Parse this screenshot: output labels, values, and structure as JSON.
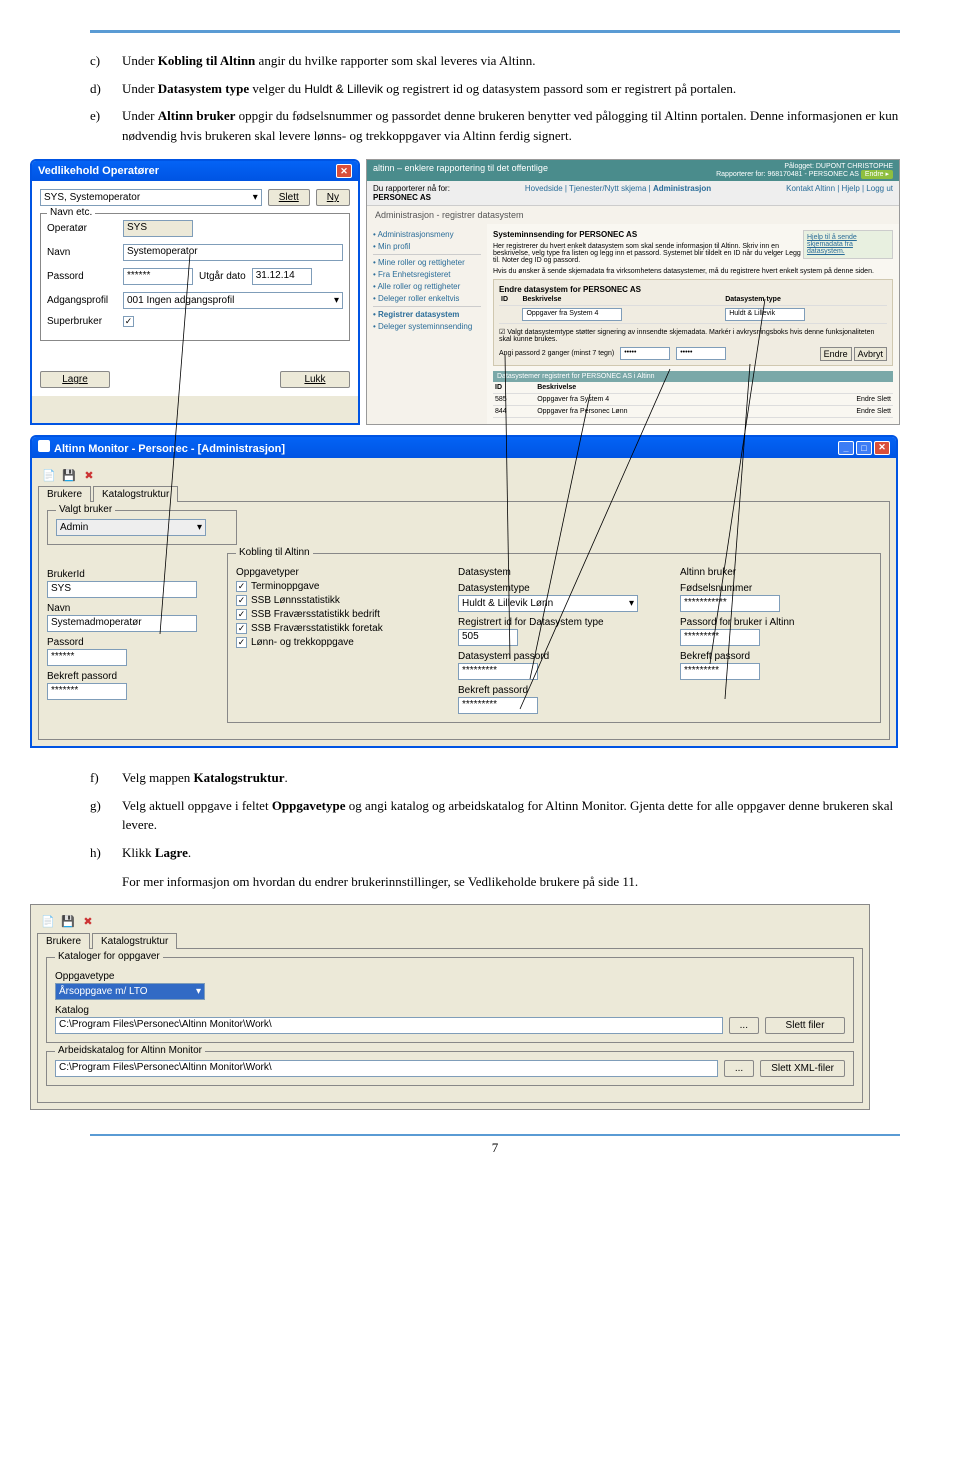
{
  "instructions": {
    "c": {
      "letter": "c)",
      "pre": "Under ",
      "b1": "Kobling til Altinn",
      "post": " angir du hvilke rapporter som skal leveres via Altinn."
    },
    "d": {
      "letter": "d)",
      "pre": "Under ",
      "b1": "Datasystem type",
      "mid1": " velger du ",
      "s1": "Huldt & Lillevik",
      "post": " og registrert id og datasystem passord som er registrert på portalen."
    },
    "e": {
      "letter": "e)",
      "pre": "Under ",
      "b1": "Altinn bruker",
      "post": " oppgir du fødselsnummer og passordet denne brukeren benytter ved pålogging til Altinn portalen. Denne informasjonen er kun nødvendig hvis brukeren skal levere lønns- og trekkoppgaver via Altinn ferdig signert."
    },
    "f": {
      "letter": "f)",
      "pre": "Velg mappen ",
      "b1": "Katalogstruktur",
      "post": "."
    },
    "g": {
      "letter": "g)",
      "pre": "Velg aktuell oppgave i feltet ",
      "b1": "Oppgavetype",
      "post": " og angi katalog og arbeidskatalog for Altinn Monitor. Gjenta dette for alle oppgaver denne brukeren skal levere."
    },
    "h": {
      "letter": "h)",
      "pre": "Klikk ",
      "b1": "Lagre",
      "post": "."
    },
    "i": "For mer informasjon om hvordan du endrer brukerinnstillinger, se Vedlikeholde brukere på side 11."
  },
  "win1": {
    "title": "Vedlikehold Operatører",
    "operator_select": "SYS, Systemoperator",
    "slett": "Slett",
    "ny": "Ny",
    "navn_etc": "Navn etc.",
    "lbl_operator": "Operatør",
    "val_operator": "SYS",
    "lbl_navn": "Navn",
    "val_navn": "Systemoperator",
    "lbl_passord": "Passord",
    "val_passord": "******",
    "lbl_utgar": "Utgår dato",
    "val_utgar": "31.12.14",
    "lbl_adgang": "Adgangsprofil",
    "val_adgang": "001 Ingen adgangsprofil",
    "lbl_super": "Superbruker",
    "lagre": "Lagre",
    "lukk": "Lukk"
  },
  "altinn": {
    "brand": "altinn – enklere rapportering til det offentlige",
    "pa_logget": "Pålogget: DUPONT CHRISTOPHE",
    "rapporterer": "Rapporterer for: 968170481 - PERSONEC AS",
    "endre": "Endre ▸",
    "rep_for": "Du rapporterer nå for:",
    "rep_org": "PERSONEC AS",
    "nav": "Hovedside | Tjenester/Nytt skjema | ",
    "nav_active": "Administrasjon",
    "nav_right": "Kontakt Altinn | Hjelp | Logg ut",
    "section": "Administrasjon - registrer datasystem",
    "side_links": [
      "Administrasjonsmeny",
      "Min profil",
      "Mine roller og rettigheter",
      "Fra Enhetsregisteret",
      "Alle roller og rettigheter",
      "Deleger roller enkeltvis",
      "Registrer datasystem",
      "Deleger systeminnsending"
    ],
    "heading1": "Systeminnsending for PERSONEC AS",
    "para1": "Her registrerer du hvert enkelt datasystem som skal sende informasjon til Altinn. Skriv inn en beskrivelse, velg type fra listen og legg inn et passord. Systemet blir tildelt en ID når du velger Legg til. Noter deg ID og passord.",
    "para2": "Hvis du ønsker å sende skjemadata fra virksomhetens datasystemer, må du registrere hvert enkelt system på denne siden.",
    "hjelp_box": "Hjelp til å sende skjemadata fra datasystem.",
    "heading2": "Endre datasystem for PERSONEC AS",
    "th_id": "ID",
    "th_besk": "Beskrivelse",
    "th_type": "Datasystem type",
    "desc_val": "Oppgaver fra System 4",
    "type_val": "Huldt & Lillevik",
    "note": "☑ Valgt datasystemtype støtter signering av innsendte skjemadata. Markér i avkrysningsboks hvis denne funksjonaliteten skal kunne brukes.",
    "pwd_label": "Angi passord 2 ganger (minst 7 tegn)",
    "pwd1": "•••••",
    "pwd2": "•••••",
    "btn_endre": "Endre",
    "btn_avbryt": "Avbryt",
    "heading3": "Datasystemer registrert for PERSONEC AS i Altinn",
    "r1_id": "585",
    "r1_desc": "Oppgaver fra System 4",
    "r2_id": "844",
    "r2_desc": "Oppgaver fra Personec Lønn",
    "act_endre": "Endre",
    "act_slett": "Slett"
  },
  "win2": {
    "title": "Altinn Monitor - Personec - [Administrasjon]",
    "tab1": "Brukere",
    "tab2": "Katalogstruktur",
    "valgt_bruker": "Valgt bruker",
    "admin": "Admin",
    "brukerid_lbl": "BrukerId",
    "brukerid_val": "SYS",
    "navn_lbl": "Navn",
    "navn_val": "Systemadmoperatør",
    "passord_lbl": "Passord",
    "passord_val": "******",
    "bekreft_lbl": "Bekreft passord",
    "bekreft_val": "*******",
    "kobling_title": "Kobling til Altinn",
    "oppgavetyper": "Oppgavetyper",
    "chk1": "Terminoppgave",
    "chk2": "SSB Lønnsstatistikk",
    "chk3": "SSB Fraværsstatistikk bedrift",
    "chk4": "SSB Fraværsstatistikk foretak",
    "chk5": "Lønn- og trekkoppgave",
    "datasystem_lbl": "Datasystem",
    "dstype_lbl": "Datasystemtype",
    "dstype_val": "Huldt & Lillevik Lønn",
    "regid_lbl": "Registrert id for Datasystem type",
    "regid_val": "505",
    "dspass_lbl": "Datasystem passord",
    "dspass_val": "*********",
    "bekpass2_lbl": "Bekreft passord",
    "bekpass2_val": "*********",
    "altbruker_lbl": "Altinn bruker",
    "fodsels_lbl": "Fødselsnummer",
    "fodsels_val": "***********",
    "passalt_lbl": "Passord for bruker i Altinn",
    "passalt_val": "*********",
    "bekpass3_lbl": "Bekreft passord",
    "bekpass3_val": "*********"
  },
  "win3": {
    "tab1": "Brukere",
    "tab2": "Katalogstruktur",
    "fset1": "Kataloger for oppgaver",
    "oppg_lbl": "Oppgavetype",
    "oppg_val": "Årsoppgave m/ LTO",
    "kat_lbl": "Katalog",
    "kat_val": "C:\\Program Files\\Personec\\Altinn Monitor\\Work\\",
    "slett_filer": "Slett filer",
    "ellipsis": "...",
    "fset2": "Arbeidskatalog for Altinn Monitor",
    "arb_val": "C:\\Program Files\\Personec\\Altinn Monitor\\Work\\",
    "slett_xml": "Slett XML-filer"
  },
  "page": "7"
}
